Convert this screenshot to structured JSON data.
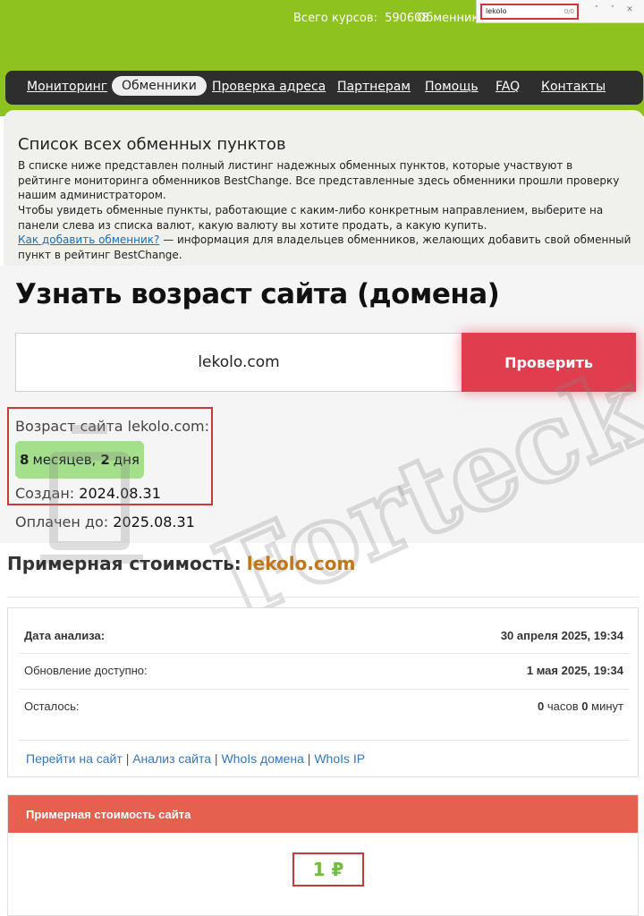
{
  "header": {
    "courses_label": "Всего курсов:",
    "courses_count": "590608",
    "exchangers_link": "Обменники"
  },
  "findbar": {
    "query": "lekolo",
    "count": "0/0",
    "prev": "˄",
    "next": "˅",
    "close": "✕"
  },
  "nav": {
    "items": [
      "Мониторинг",
      "Обменники",
      "Проверка адреса",
      "Партнерам",
      "Помощь",
      "FAQ",
      "Контакты"
    ],
    "active": "Обменники"
  },
  "description": {
    "title": "Список всех обменных пунктов",
    "p1": "В списке ниже представлен полный листинг надежных обменных пунктов, которые участвуют в рейтинге мониторинга обменников BestChange. Все представленные здесь обменники прошли проверку нашим администратором.",
    "p2": "Чтобы увидеть обменные пункты, работающие с каким-либо конкретным направлением, выберите на панели слева из списка валют, какую валюту вы хотите продать, а какую купить.",
    "link": "Как добавить обменник?",
    "p3_rest": " — информация для владельцев обменников, желающих добавить свой обменный пункт в рейтинг BestChange."
  },
  "age_check": {
    "title": "Узнать возраст сайта (домена)",
    "input_value": "lekolo.com",
    "button": "Проверить",
    "age_label": "Возраст сайта lekolo.com:",
    "age_months_num": "8",
    "age_months_word": "месяцев,",
    "age_days_num": "2",
    "age_days_word": "дня",
    "created_label": "Создан:",
    "created_value": "2024.08.31",
    "paid_label": "Оплачен до:",
    "paid_value": "2025.08.31"
  },
  "cost": {
    "title": "Примерная стоимость:",
    "domain": "lekolo.com",
    "rows": [
      {
        "label": "Дата анализа:",
        "value": "30 апреля 2025, 19:34"
      },
      {
        "label": "Обновление доступно:",
        "value": "1 мая 2025, 19:34"
      }
    ],
    "remaining_label": "Осталось:",
    "remaining_hours": "0",
    "remaining_hours_unit": "часов",
    "remaining_minutes": "0",
    "remaining_minutes_unit": "минут",
    "links": [
      "Перейти на сайт",
      "Анализ сайта",
      "WhoIs домена",
      "WhoIs IP"
    ],
    "separator": "|",
    "price_header": "Примерная стоимость сайта",
    "price": "1 ₽"
  },
  "watermark_text": "Forteck",
  "colors": {
    "header_green": "#8ec21e",
    "nav_dark": "#2e2e2e",
    "check_button": "#e03d4e",
    "age_badge": "#a4df8c",
    "domain_orange": "#c07718",
    "price_header": "#e5604f",
    "price_green": "#6fbe3c",
    "highlight_red": "#c83a3a"
  }
}
